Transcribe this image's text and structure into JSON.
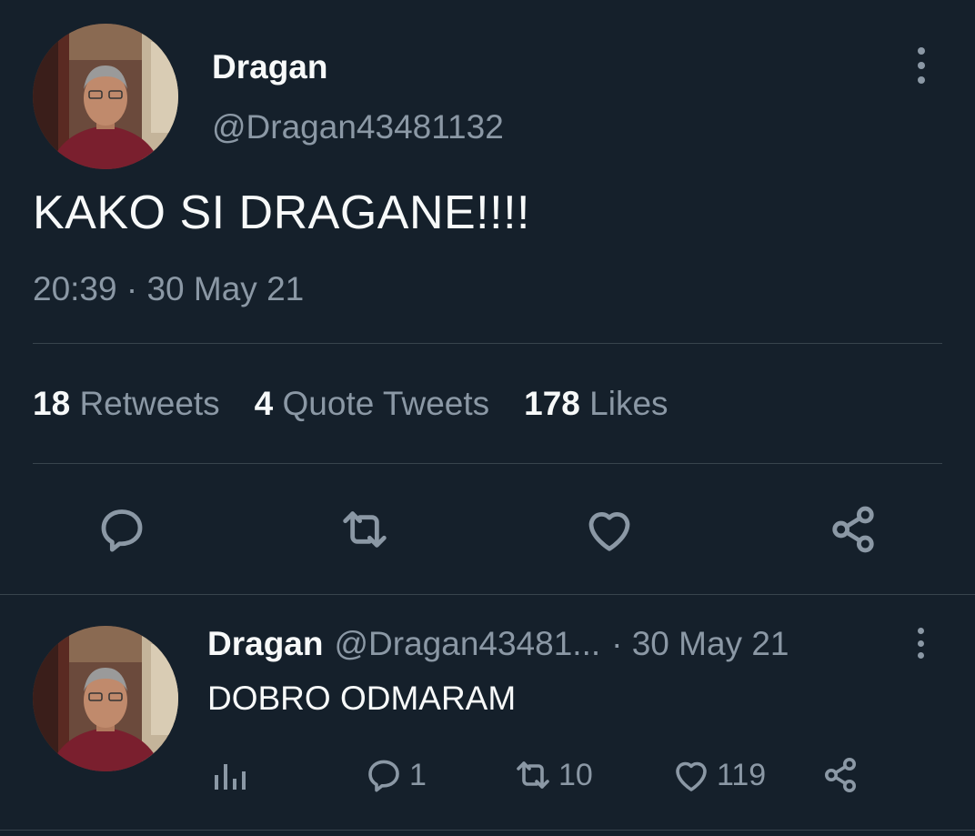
{
  "tweet": {
    "author_name": "Dragan",
    "author_handle": "@Dragan43481132",
    "text": "KAKO SI DRAGANE!!!!",
    "timestamp": "20:39 · 30 May 21",
    "stats": {
      "retweets_count": "18",
      "retweets_label": "Retweets",
      "quotes_count": "4",
      "quotes_label": "Quote Tweets",
      "likes_count": "178",
      "likes_label": "Likes"
    },
    "actions": [
      "reply-icon",
      "retweet-icon",
      "like-icon",
      "share-icon"
    ]
  },
  "reply": {
    "author_name": "Dragan",
    "author_handle": "@Dragan43481...",
    "date": "· 30 May 21",
    "text": "DOBRO ODMARAM",
    "counts": {
      "analytics": "",
      "replies": "1",
      "retweets": "10",
      "likes": "119"
    }
  },
  "colors": {
    "background": "#15202b",
    "primary_text": "#f7f9f9",
    "secondary_text": "#8b98a5",
    "divider": "#38444d"
  }
}
